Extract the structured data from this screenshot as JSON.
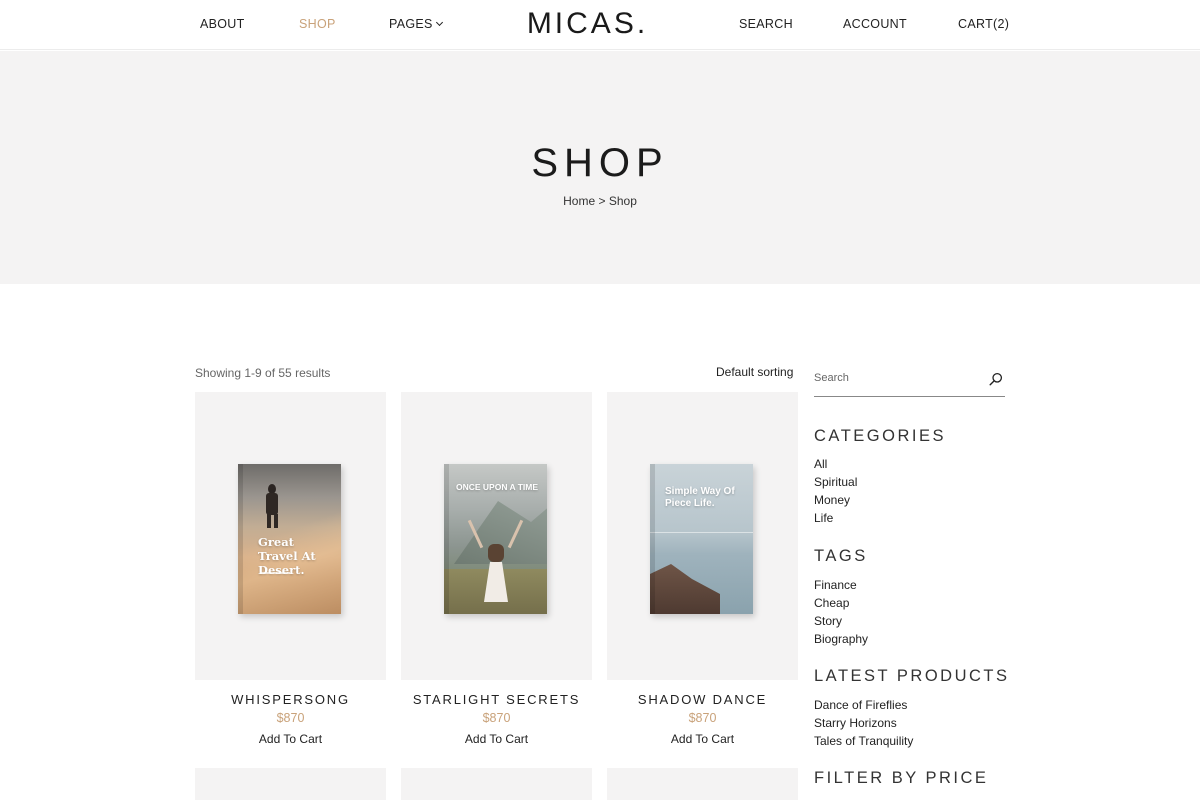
{
  "header": {
    "logo": "MICAS.",
    "nav_left": [
      {
        "label": "ABOUT"
      },
      {
        "label": "SHOP"
      },
      {
        "label": "PAGES"
      }
    ],
    "nav_right": [
      {
        "label": "SEARCH"
      },
      {
        "label": "ACCOUNT"
      },
      {
        "label": "CART(2)"
      }
    ],
    "active_nav": "SHOP"
  },
  "hero": {
    "title": "SHOP",
    "breadcrumb": {
      "home": "Home",
      "separator": ">",
      "current": "Shop"
    }
  },
  "toolbar": {
    "results_text": "Showing 1-9 of 55 results",
    "sorting_label": "Default sorting"
  },
  "products": [
    {
      "name": "WHISPERSONG",
      "price": "$870",
      "cart_label": "Add To Cart",
      "cover_text": "Great Travel At Desert."
    },
    {
      "name": "STARLIGHT SECRETS",
      "price": "$870",
      "cart_label": "Add To Cart",
      "cover_text": "ONCE UPON A TIME"
    },
    {
      "name": "SHADOW DANCE",
      "price": "$870",
      "cart_label": "Add To Cart",
      "cover_text": "Simple Way Of Piece Life."
    }
  ],
  "sidebar": {
    "search_placeholder": "Search",
    "categories": {
      "title": "CATEGORIES",
      "items": [
        "All",
        "Spiritual",
        "Money",
        "Life"
      ]
    },
    "tags": {
      "title": "TAGS",
      "items": [
        "Finance",
        "Cheap",
        "Story",
        "Biography"
      ]
    },
    "latest": {
      "title": "LATEST PRODUCTS",
      "items": [
        "Dance of Fireflies",
        "Starry Horizons",
        "Tales of Tranquility"
      ]
    },
    "filter_title": "FILTER BY PRICE"
  },
  "colors": {
    "accent": "#c9a27a",
    "hero_bg": "#f4f3f3",
    "card_bg": "#f4f3f3"
  }
}
